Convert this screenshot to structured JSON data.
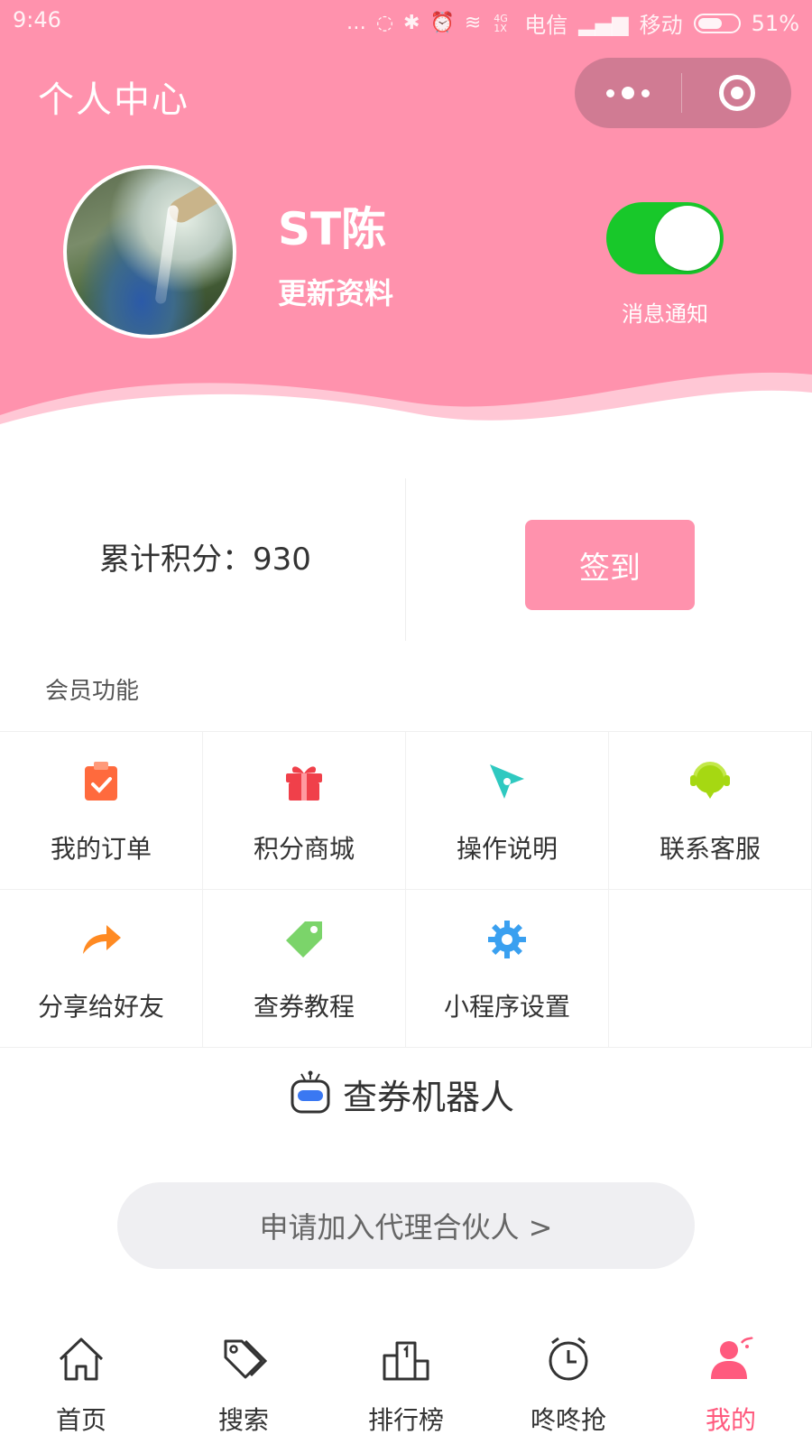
{
  "status_bar": {
    "time": "9:46",
    "icons_text": "… ◌ ✱ ⏰ ≋",
    "signal_text": "4G 1X",
    "carrier1": "电信",
    "carrier2": "移动",
    "battery": "51%"
  },
  "header": {
    "title": "个人中心",
    "bg_color": "#ff92ad"
  },
  "profile": {
    "name": "ST陈",
    "update_link": "更新资料",
    "notify_label": "消息通知",
    "notify_on": true
  },
  "points": {
    "text": "累计积分：930",
    "signin_label": "签到"
  },
  "member": {
    "section_label": "会员功能",
    "items": [
      {
        "label": "我的订单",
        "icon": "clipboard-check-icon",
        "color": "#ff6a3d"
      },
      {
        "label": "积分商城",
        "icon": "gift-icon",
        "color": "#f0404a"
      },
      {
        "label": "操作说明",
        "icon": "compass-icon",
        "color": "#2fc9c0"
      },
      {
        "label": "联系客服",
        "icon": "headset-icon",
        "color": "#a6d812"
      },
      {
        "label": "分享给好友",
        "icon": "share-arrow-icon",
        "color": "#ff8a22"
      },
      {
        "label": "查券教程",
        "icon": "tag-icon",
        "color": "#7bd46a"
      },
      {
        "label": "小程序设置",
        "icon": "settings-gear-icon",
        "color": "#3aa0f0"
      }
    ]
  },
  "robot": {
    "title": "查券机器人"
  },
  "partner": {
    "label": "申请加入代理合伙人 >"
  },
  "tabbar": {
    "items": [
      {
        "label": "首页",
        "icon": "home-icon",
        "active": false
      },
      {
        "label": "搜索",
        "icon": "search-tags-icon",
        "active": false
      },
      {
        "label": "排行榜",
        "icon": "podium-icon",
        "active": false
      },
      {
        "label": "咚咚抢",
        "icon": "alarm-clock-icon",
        "active": false
      },
      {
        "label": "我的",
        "icon": "profile-icon",
        "active": true
      }
    ]
  }
}
